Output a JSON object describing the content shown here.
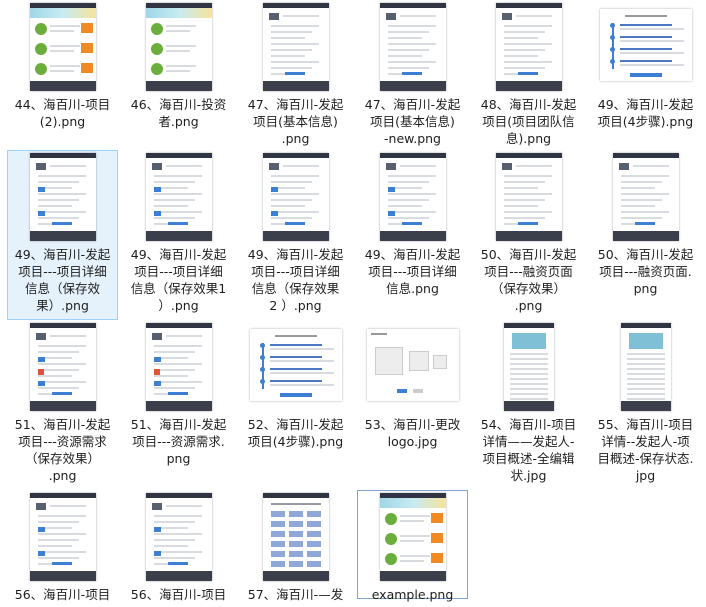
{
  "files": [
    {
      "name": "44、海百川-项目(2).png",
      "label": "44、海百川-项目\n(2).png",
      "thumb": "portal"
    },
    {
      "name": "46、海百川-投资者.png",
      "label": "46、海百川-投资\n者.png",
      "thumb": "investor"
    },
    {
      "name": "47、海百川-发起项目(基本信息).png",
      "label": "47、海百川-发起\n项目(基本信息)\n.png",
      "thumb": "form"
    },
    {
      "name": "47、海百川-发起项目(基本信息)-new.png",
      "label": "47、海百川-发起\n项目(基本信息)\n-new.png",
      "thumb": "form"
    },
    {
      "name": "48、海百川-发起项目(项目团队信息).png",
      "label": "48、海百川-发起\n项目(项目团队信\n息).png",
      "thumb": "form"
    },
    {
      "name": "49、海百川-发起项目(4步骤).png",
      "label": "49、海百川-发起\n项目(4步骤).png",
      "thumb": "steps"
    },
    {
      "name": "49、海百川-发起项目---项目详细信息（保存效果）.png",
      "label": "49、海百川-发起\n项目---项目详细\n信息（保存效\n果）.png",
      "thumb": "detail"
    },
    {
      "name": "49、海百川-发起项目---项目详细信息（保存效果1）.png",
      "label": "49、海百川-发起\n项目---项目详细\n信息（保存效果1\n）.png",
      "thumb": "detail"
    },
    {
      "name": "49、海百川-发起项目---项目详细信息（保存效果2）.png",
      "label": "49、海百川-发起\n项目---项目详细\n信息（保存效果\n2 ）.png",
      "thumb": "detail"
    },
    {
      "name": "49、海百川-发起项目---项目详细信息.png",
      "label": "49、海百川-发起\n项目---项目详细\n信息.png",
      "thumb": "detail"
    },
    {
      "name": "50、海百川-发起项目---融资页面（保存效果）.png",
      "label": "50、海百川-发起\n项目---融资页面\n（保存效果）\n.png",
      "thumb": "finance"
    },
    {
      "name": "50、海百川-发起项目---融资页面.png",
      "label": "50、海百川-发起\n项目---融资页面.\npng",
      "thumb": "finance"
    },
    {
      "name": "51、海百川-发起项目---资源需求（保存效果）.png",
      "label": "51、海百川-发起\n项目---资源需求\n（保存效果）\n.png",
      "thumb": "resource"
    },
    {
      "name": "51、海百川-发起项目---资源需求.png",
      "label": "51、海百川-发起\n项目---资源需求.\npng",
      "thumb": "resource"
    },
    {
      "name": "52、海百川-发起项目(4步骤).png",
      "label": "52、海百川-发起\n项目(4步骤).png",
      "thumb": "steps"
    },
    {
      "name": "53、海百川-更改logo.jpg",
      "label": "53、海百川-更改\nlogo.jpg",
      "thumb": "dialog"
    },
    {
      "name": "54、海百川-项目详情——发起人-项目概述-全编辑状.jpg",
      "label": "54、海百川-项目\n详情——发起人-\n项目概述-全编辑\n状.jpg",
      "thumb": "tall"
    },
    {
      "name": "55、海百川-项目详情--发起人-项目概述-保存状态.jpg",
      "label": "55、海百川-项目\n详情--发起人-项\n目概述-保存状态.\njpg",
      "thumb": "tall"
    },
    {
      "name": "56、海百川-项目",
      "label": "56、海百川-项目",
      "thumb": "detail"
    },
    {
      "name": "56、海百川-项目",
      "label": "56、海百川-项目",
      "thumb": "detail"
    },
    {
      "name": "57、海百川-一发",
      "label": "57、海百川-—发",
      "thumb": "grid"
    },
    {
      "name": "example.png",
      "label": "example.png",
      "thumb": "portal"
    }
  ],
  "icons": {
    "thumbnail": "image-file-thumbnail-icon"
  }
}
